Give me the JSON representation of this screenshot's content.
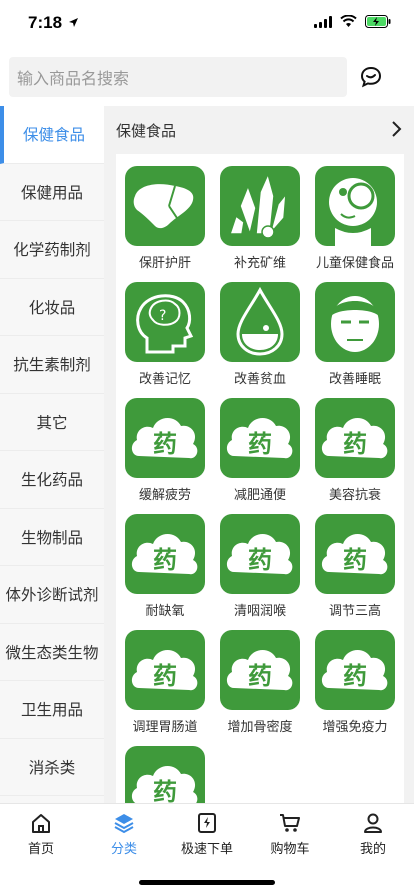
{
  "status_bar": {
    "time": "7:18"
  },
  "search": {
    "placeholder": "输入商品名搜索"
  },
  "sidebar": {
    "items": [
      {
        "label": "保健食品",
        "active": true
      },
      {
        "label": "保健用品"
      },
      {
        "label": "化学药制剂"
      },
      {
        "label": "化妆品"
      },
      {
        "label": "抗生素制剂"
      },
      {
        "label": "其它"
      },
      {
        "label": "生化药品"
      },
      {
        "label": "生物制品"
      },
      {
        "label": "体外诊断试剂"
      },
      {
        "label": "微生态类生物"
      },
      {
        "label": "卫生用品"
      },
      {
        "label": "消杀类"
      }
    ]
  },
  "content": {
    "title": "保健食品",
    "tiles": [
      {
        "label": "保肝护肝",
        "icon": "liver-icon"
      },
      {
        "label": "补充矿维",
        "icon": "crystal-icon"
      },
      {
        "label": "儿童保健食品",
        "icon": "child-icon"
      },
      {
        "label": "改善记忆",
        "icon": "brain-icon"
      },
      {
        "label": "改善贫血",
        "icon": "blood-drop-icon"
      },
      {
        "label": "改善睡眠",
        "icon": "sleepy-face-icon"
      },
      {
        "label": "缓解疲劳",
        "icon": "medicine-cloud-icon"
      },
      {
        "label": "减肥通便",
        "icon": "medicine-cloud-icon"
      },
      {
        "label": "美容抗衰",
        "icon": "medicine-cloud-icon"
      },
      {
        "label": "耐缺氧",
        "icon": "medicine-cloud-icon"
      },
      {
        "label": "清咽润喉",
        "icon": "medicine-cloud-icon"
      },
      {
        "label": "调节三高",
        "icon": "medicine-cloud-icon"
      },
      {
        "label": "调理胃肠道",
        "icon": "medicine-cloud-icon"
      },
      {
        "label": "增加骨密度",
        "icon": "medicine-cloud-icon"
      },
      {
        "label": "增强免疫力",
        "icon": "medicine-cloud-icon"
      },
      {
        "label": "",
        "icon": "medicine-cloud-icon"
      }
    ],
    "cloud_glyph": "药"
  },
  "tabbar": {
    "items": [
      {
        "label": "首页",
        "icon": "home-icon"
      },
      {
        "label": "分类",
        "icon": "layers-icon",
        "active": true
      },
      {
        "label": "极速下单",
        "icon": "quick-order-icon"
      },
      {
        "label": "购物车",
        "icon": "cart-icon"
      },
      {
        "label": "我的",
        "icon": "user-icon"
      }
    ]
  },
  "colors": {
    "accent": "#3d8ee8",
    "tile_green": "#3f9a3b"
  }
}
